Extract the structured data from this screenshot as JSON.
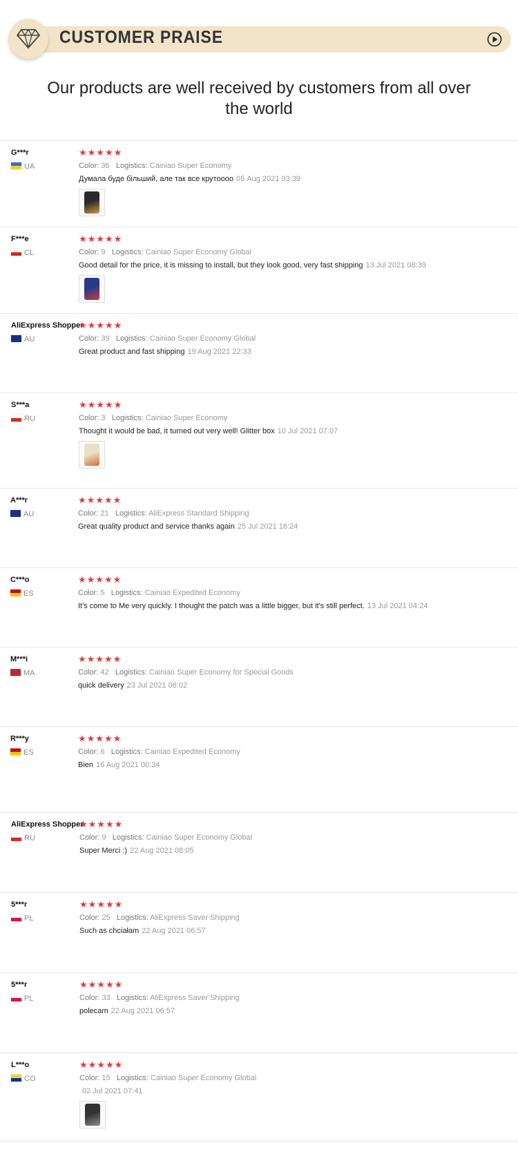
{
  "header": {
    "title": "CUSTOMER PRAISE",
    "intro": "Our products are well received by customers from all over the world"
  },
  "labels": {
    "color": "Color:",
    "logistics": "Logistics:"
  },
  "reviews": [
    {
      "name": "G***r",
      "country": "UA",
      "stars": "★★★★★",
      "color": "36",
      "logistics": "Cainiao Super Economy",
      "text": "Думала буде більший, але так все крутоооо",
      "date": "05 Aug 2021 03:39",
      "flag": [
        "#2f6fd8",
        "#f6d321"
      ]
    },
    {
      "name": "F***e",
      "country": "CL",
      "stars": "★★★★★",
      "color": "9",
      "logistics": "Cainiao Super Economy Global",
      "text": "Good detail for the price, it is missing to install, but they look good, very fast shipping",
      "date": "13 Jul 2021 08:39",
      "flag": [
        "#ffffff",
        "#d52b1e"
      ]
    },
    {
      "name": "AliExpress Shopper",
      "country": "AU",
      "stars": "★★★★★",
      "color": "39",
      "logistics": "Cainiao Super Economy Global",
      "text": "Great product and fast shipping",
      "date": "19 Aug 2021 22:33",
      "flag": [
        "#1a2f8a",
        "#1a2f8a"
      ]
    },
    {
      "name": "S***a",
      "country": "RU",
      "stars": "★★★★★",
      "color": "3",
      "logistics": "Cainiao Super Economy",
      "text": "Thought it would be bad, it turned out very well! Glitter box",
      "date": "10 Jul 2021 07:07",
      "flag": [
        "#ffffff",
        "#d52b1e"
      ]
    },
    {
      "name": "A***r",
      "country": "AU",
      "stars": "★★★★★",
      "color": "21",
      "logistics": "AliExpress Standard Shipping",
      "text": "Great quality product and service thanks again",
      "date": "25 Jul 2021 16:24",
      "flag": [
        "#1a2f8a",
        "#1a2f8a"
      ]
    },
    {
      "name": "C***o",
      "country": "ES",
      "stars": "★★★★★",
      "color": "5",
      "logistics": "Cainiao Expedited Economy",
      "text": "It's come to Me very quickly. I thought the patch was a little bigger, but it's still perfect.",
      "date": "13 Jul 2021 04:24",
      "flag": [
        "#c60b1e",
        "#ffc400"
      ]
    },
    {
      "name": "M***i",
      "country": "MA",
      "stars": "★★★★★",
      "color": "42",
      "logistics": "Cainiao Super Economy for Special Goods",
      "text": "quick delivery",
      "date": "23 Jul 2021 06:02",
      "flag": [
        "#c1272d",
        "#c1272d"
      ]
    },
    {
      "name": "R***y",
      "country": "ES",
      "stars": "★★★★★",
      "color": "6",
      "logistics": "Cainiao Expedited Economy",
      "text": "Bien",
      "date": "16 Aug 2021 00:34",
      "flag": [
        "#c60b1e",
        "#ffc400"
      ]
    },
    {
      "name": "AliExpress Shopper",
      "country": "RU",
      "stars": "★★★★★",
      "color": "9",
      "logistics": "Cainiao Super Economy Global",
      "text": "Super Merci :)",
      "date": "22 Aug 2021 08:05",
      "flag": [
        "#ffffff",
        "#d52b1e"
      ]
    },
    {
      "name": "5***r",
      "country": "PL",
      "stars": "★★★★★",
      "color": "25",
      "logistics": "AliExpress Saver Shipping",
      "text": "Such as chciałam",
      "date": "22 Aug 2021 06:57",
      "flag": [
        "#ffffff",
        "#dc143c"
      ]
    },
    {
      "name": "5***r",
      "country": "PL",
      "stars": "★★★★★",
      "color": "33",
      "logistics": "AliExpress Saver Shipping",
      "text": "polecam",
      "date": "22 Aug 2021 06:57",
      "flag": [
        "#ffffff",
        "#dc143c"
      ]
    },
    {
      "name": "L***o",
      "country": "CO",
      "stars": "★★★★★",
      "color": "15",
      "logistics": "Cainiao Super Economy Global",
      "text": "",
      "date": "02 Jul 2021 07:41",
      "flag": [
        "#fcd116",
        "#003893"
      ]
    }
  ]
}
